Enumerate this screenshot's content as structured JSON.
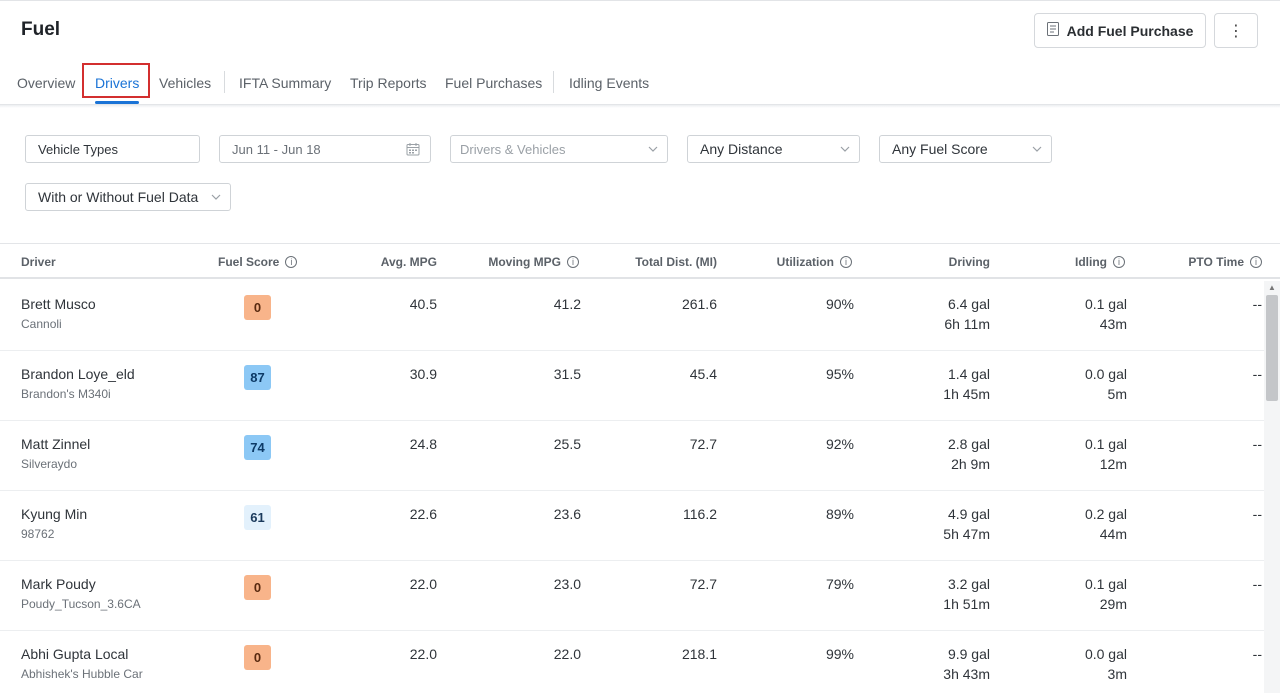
{
  "header": {
    "title": "Fuel",
    "add_button_label": "Add Fuel Purchase",
    "more_label": "⋮"
  },
  "tabs": [
    {
      "label": "Overview",
      "active": false
    },
    {
      "label": "Drivers",
      "active": true
    },
    {
      "label": "Vehicles",
      "active": false
    },
    {
      "label": "IFTA Summary",
      "active": false
    },
    {
      "label": "Trip Reports",
      "active": false
    },
    {
      "label": "Fuel Purchases",
      "active": false
    },
    {
      "label": "Idling Events",
      "active": false
    }
  ],
  "filters": {
    "vehicle_types": "Vehicle Types",
    "date_range": "Jun 11 - Jun 18",
    "drivers_vehicles": "Drivers & Vehicles",
    "distance": "Any Distance",
    "fuel_score": "Any Fuel Score",
    "fuel_data": "With or Without Fuel Data"
  },
  "table": {
    "columns": {
      "driver": "Driver",
      "fuel_score": "Fuel Score",
      "avg_mpg": "Avg. MPG",
      "moving_mpg": "Moving MPG",
      "total_dist": "Total Dist. (MI)",
      "utilization": "Utilization",
      "driving": "Driving",
      "idling": "Idling",
      "pto_time": "PTO Time"
    },
    "rows": [
      {
        "name": "Brett Musco",
        "vehicle": "Cannoli",
        "score": "0",
        "avg_mpg": "40.5",
        "moving_mpg": "41.2",
        "dist": "261.6",
        "util": "90%",
        "driving_gal": "6.4 gal",
        "driving_time": "6h 11m",
        "idling_gal": "0.1 gal",
        "idling_time": "43m",
        "pto": "--"
      },
      {
        "name": "Brandon Loye_eld",
        "vehicle": "Brandon's M340i",
        "score": "87",
        "avg_mpg": "30.9",
        "moving_mpg": "31.5",
        "dist": "45.4",
        "util": "95%",
        "driving_gal": "1.4 gal",
        "driving_time": "1h 45m",
        "idling_gal": "0.0 gal",
        "idling_time": "5m",
        "pto": "--"
      },
      {
        "name": "Matt Zinnel",
        "vehicle": "Silveraydo",
        "score": "74",
        "avg_mpg": "24.8",
        "moving_mpg": "25.5",
        "dist": "72.7",
        "util": "92%",
        "driving_gal": "2.8 gal",
        "driving_time": "2h 9m",
        "idling_gal": "0.1 gal",
        "idling_time": "12m",
        "pto": "--"
      },
      {
        "name": "Kyung Min",
        "vehicle": "98762",
        "score": "61",
        "avg_mpg": "22.6",
        "moving_mpg": "23.6",
        "dist": "116.2",
        "util": "89%",
        "driving_gal": "4.9 gal",
        "driving_time": "5h 47m",
        "idling_gal": "0.2 gal",
        "idling_time": "44m",
        "pto": "--"
      },
      {
        "name": "Mark Poudy",
        "vehicle": "Poudy_Tucson_3.6CA",
        "score": "0",
        "avg_mpg": "22.0",
        "moving_mpg": "23.0",
        "dist": "72.7",
        "util": "79%",
        "driving_gal": "3.2 gal",
        "driving_time": "1h 51m",
        "idling_gal": "0.1 gal",
        "idling_time": "29m",
        "pto": "--"
      },
      {
        "name": "Abhi Gupta Local",
        "vehicle": "Abhishek's Hubble Car",
        "score": "0",
        "avg_mpg": "22.0",
        "moving_mpg": "22.0",
        "dist": "218.1",
        "util": "99%",
        "driving_gal": "9.9 gal",
        "driving_time": "3h 43m",
        "idling_gal": "0.0 gal",
        "idling_time": "3m",
        "pto": "--"
      }
    ]
  },
  "score_colors": {
    "low": {
      "bg": "#f8b48a",
      "fg": "#5a2a10"
    },
    "high": {
      "bg": "#8cc8f5",
      "fg": "#0d3a66"
    },
    "mid": {
      "bg": "#e3f1fc",
      "fg": "#1b3a5c"
    }
  }
}
